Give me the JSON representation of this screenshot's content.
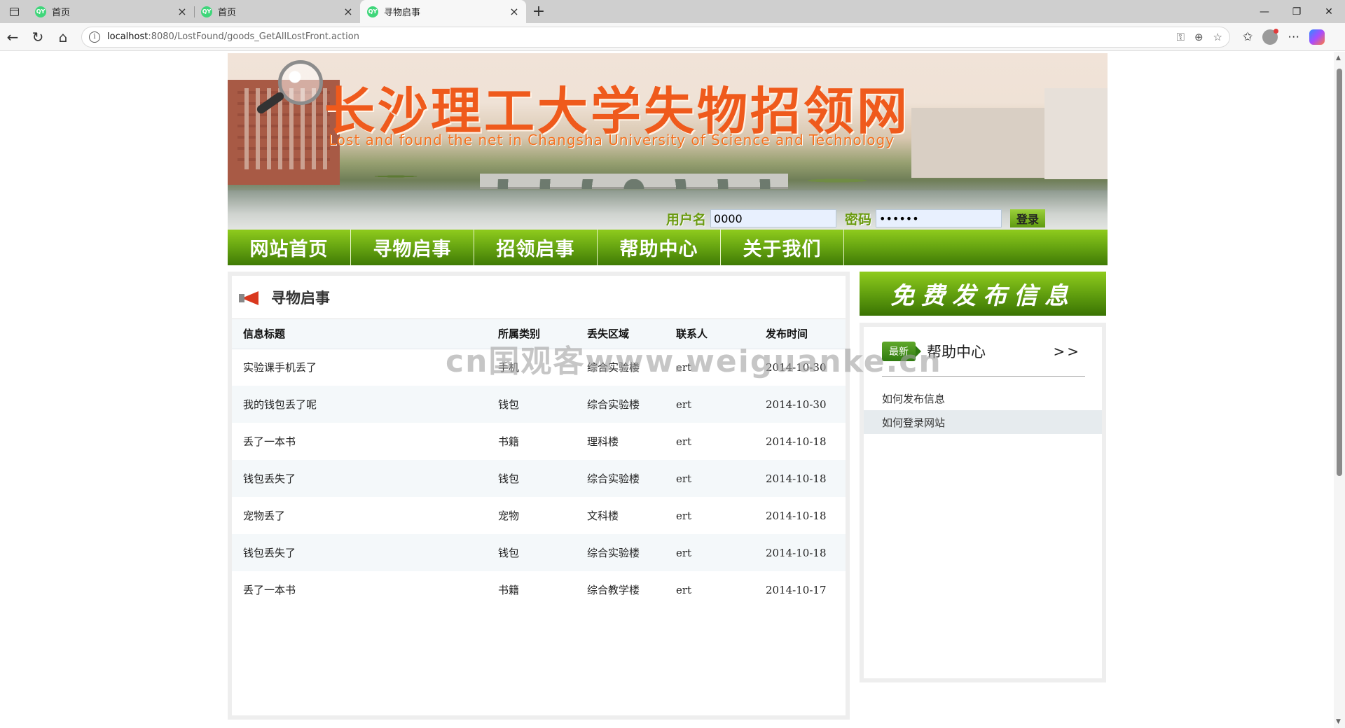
{
  "browser": {
    "tabs": [
      {
        "title": "首页",
        "favicon": "QY",
        "active": false
      },
      {
        "title": "首页",
        "favicon": "QY",
        "active": false
      },
      {
        "title": "寻物启事",
        "favicon": "QY",
        "active": true
      }
    ],
    "url_host": "localhost",
    "url_path": ":8080/LostFound/goods_GetAllLostFront.action"
  },
  "banner": {
    "title": "长沙理工大学失物招领网",
    "subtitle": "Lost and found the net in Changsha University of Science and Technology"
  },
  "login": {
    "username_label": "用户名",
    "username_value": "0000",
    "password_label": "密码",
    "password_value": "••••••",
    "submit_label": "登录"
  },
  "nav": {
    "items": [
      "网站首页",
      "寻物启事",
      "招领启事",
      "帮助中心",
      "关于我们"
    ]
  },
  "lost_panel": {
    "title": "寻物启事",
    "columns": [
      "信息标题",
      "所属类别",
      "丢失区域",
      "联系人",
      "发布时间"
    ],
    "rows": [
      [
        "实验课手机丢了",
        "手机",
        "综合实验楼",
        "ert",
        "2014-10-30"
      ],
      [
        "我的钱包丢了呢",
        "钱包",
        "综合实验楼",
        "ert",
        "2014-10-30"
      ],
      [
        "丢了一本书",
        "书籍",
        "理科楼",
        "ert",
        "2014-10-18"
      ],
      [
        "钱包丢失了",
        "钱包",
        "综合实验楼",
        "ert",
        "2014-10-18"
      ],
      [
        "宠物丢了",
        "宠物",
        "文科楼",
        "ert",
        "2014-10-18"
      ],
      [
        "钱包丢失了",
        "钱包",
        "综合实验楼",
        "ert",
        "2014-10-18"
      ],
      [
        "丢了一本书",
        "书籍",
        "综合教学楼",
        "ert",
        "2014-10-17"
      ]
    ]
  },
  "sidebar": {
    "publish_label": "免费发布信息",
    "help_badge": "最新",
    "help_title": "帮助中心",
    "help_more": ">>",
    "help_items": [
      "如何发布信息",
      "如何登录网站"
    ]
  },
  "watermark": "cn国观客www.weiguanke.cn",
  "colors": {
    "nav_green": "#6aa812",
    "title_orange": "#ef5a1c",
    "label_green": "#6a9a10"
  }
}
